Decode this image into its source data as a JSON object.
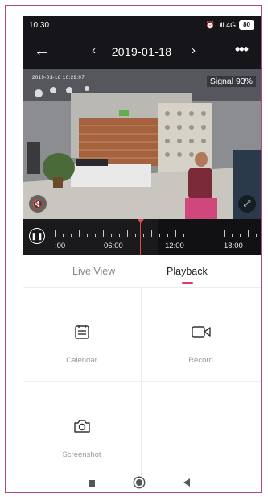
{
  "status_bar": {
    "time": "10:30",
    "indicators": "… ⏰ .ıll 4G",
    "battery": "80"
  },
  "header": {
    "date": "2019-01-18",
    "back_icon": "back-arrow-icon",
    "prev_icon": "chevron-left-icon",
    "next_icon": "chevron-right-icon",
    "more_icon": "more-dots-icon"
  },
  "video": {
    "signal_label": "Signal",
    "signal_value": "93%",
    "osd_text": "2019-01-18 10:29:07"
  },
  "timeline": {
    "labels": [
      ":00",
      "06:00",
      "12:00",
      "18:00"
    ]
  },
  "tabs": {
    "live_view": "Live View",
    "playback": "Playback"
  },
  "actions": {
    "calendar": "Calendar",
    "record": "Record",
    "screenshot": "Screenshot"
  },
  "colors": {
    "accent": "#e5356f",
    "dark_bar": "#16161a",
    "frame_border": "#b0458f"
  }
}
